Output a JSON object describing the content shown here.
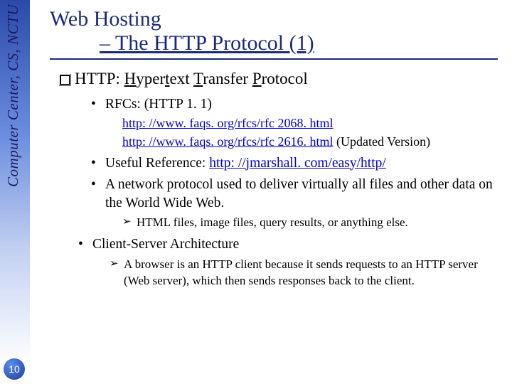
{
  "sidebar": {
    "text": "Computer Center, CS, NCTU",
    "page_number": "10"
  },
  "title": {
    "line1": "Web Hosting",
    "line2": "– The HTTP Protocol (1)"
  },
  "main_point": {
    "prefix": "HTTP: ",
    "h": "H",
    "yper": "yper",
    "t": "t",
    "ext": "ext ",
    "tt": "T",
    "ransfer": "ransfer ",
    "p": "P",
    "rotocol": "rotocol"
  },
  "bullets": {
    "b1": {
      "text": "RFCs: (HTTP 1. 1)",
      "link1": "http: //www. faqs. org/rfcs/rfc 2068. html",
      "link2": "http: //www. faqs. org/rfcs/rfc 2616. html",
      "link2_suffix": "  (Updated Version)"
    },
    "b2": {
      "prefix": "Useful Reference: ",
      "link": "http: //jmarshall. com/easy/http/"
    },
    "b3": {
      "text": "A network protocol used to deliver virtually all files and other data on the World Wide Web.",
      "sub": "HTML files, image files, query results, or anything else."
    },
    "b4": {
      "text": "Client-Server Architecture",
      "sub": "A browser is an HTTP client because it sends requests to an HTTP server (Web server), which then sends responses back to the client."
    }
  }
}
